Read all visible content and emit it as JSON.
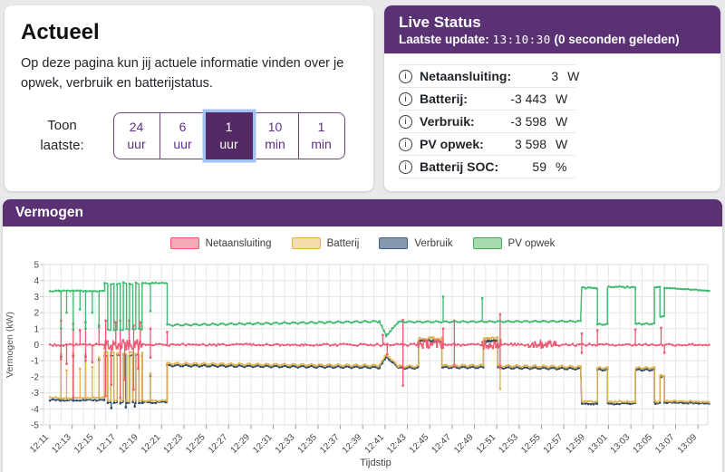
{
  "left_card": {
    "title": "Actueel",
    "description": "Op deze pagina kun jij actuele informatie vinden over je opwek, verbruik en batterijstatus.",
    "toon_label_line1": "Toon",
    "toon_label_line2": "laatste:",
    "buttons": [
      {
        "line1": "24",
        "line2": "uur",
        "selected": false
      },
      {
        "line1": "6",
        "line2": "uur",
        "selected": false
      },
      {
        "line1": "1",
        "line2": "uur",
        "selected": true
      },
      {
        "line1": "10",
        "line2": "min",
        "selected": false
      },
      {
        "line1": "1",
        "line2": "min",
        "selected": false
      }
    ]
  },
  "live_status": {
    "title": "Live Status",
    "update_label": "Laatste update:",
    "update_time": "13:10:30",
    "update_ago": "(0 seconden geleden)",
    "rows": [
      {
        "label": "Netaansluiting:",
        "value": "3",
        "unit": "W"
      },
      {
        "label": "Batterij:",
        "value": "-3 443",
        "unit": "W"
      },
      {
        "label": "Verbruik:",
        "value": "-3 598",
        "unit": "W"
      },
      {
        "label": "PV opwek:",
        "value": "3 598",
        "unit": "W"
      },
      {
        "label": "Batterij SOC:",
        "value": "59",
        "unit": "%"
      }
    ]
  },
  "chart_card": {
    "title": "Vermogen"
  },
  "colors": {
    "accent_purple": "#5a3173",
    "selected_button": "#542a64",
    "focus_ring": "#a3c4f3",
    "page_bg": "#e9e9eb"
  },
  "chart_data": {
    "type": "line",
    "xlabel": "Tijdstip",
    "ylabel": "Vermogen (kW)",
    "ylim": [
      -5,
      5
    ],
    "y_tick_step": 1,
    "x_minutes_span": 59.5,
    "x_tick_every_min": 2,
    "x_minor_grid_min": 1,
    "grid": true,
    "legend_position": "top-center",
    "x_tick_labels": [
      "12:11",
      "12:13",
      "12:15",
      "12:17",
      "12:19",
      "12:21",
      "12:23",
      "12:25",
      "12:27",
      "12:29",
      "12:31",
      "12:33",
      "12:35",
      "12:37",
      "12:39",
      "12:41",
      "12:43",
      "12:45",
      "12:47",
      "12:49",
      "12:51",
      "12:53",
      "12:55",
      "12:57",
      "12:59",
      "13:01",
      "13:03",
      "13:05",
      "13:07",
      "13:09"
    ],
    "seed": 1337,
    "legend": [
      {
        "name": "Netaansluiting",
        "fill": "#f6aab8",
        "border": "#ee5873"
      },
      {
        "name": "Batterij",
        "fill": "#f3ddab",
        "border": "#e0b14c"
      },
      {
        "name": "Verbruik",
        "fill": "#8499ad",
        "border": "#43647f"
      },
      {
        "name": "PV opwek",
        "fill": "#a5dbad",
        "border": "#42a864"
      }
    ],
    "series": [
      {
        "name": "Verbruik",
        "color": "#2f4a63",
        "z": 1,
        "segments": [
          {
            "t0": 0,
            "t1": 0.8,
            "v0": -3.45,
            "v1": -3.45,
            "noise": 0.04,
            "dt": 0.15
          },
          {
            "t0": 0.8,
            "t1": 4.9,
            "v0": -3.46,
            "v1": -3.46,
            "noise": 0.05,
            "dt": 0.15
          },
          {
            "type": "square",
            "t0": 4.9,
            "t1": 8.3,
            "hi": -0.65,
            "lo": -3.62,
            "period": 0.56,
            "noise": 0.08
          },
          {
            "t0": 8.3,
            "t1": 10.5,
            "v0": -3.6,
            "v1": -3.6,
            "noise": 0.05,
            "dt": 0.15
          },
          {
            "t0": 10.5,
            "t1": 29.5,
            "v0": -1.3,
            "v1": -1.42,
            "wave": 0.05,
            "wp": 0.8,
            "dt": 0.12
          },
          {
            "t0": 29.5,
            "t1": 30.1,
            "v0": -1.42,
            "v1": -0.75,
            "noise": 0.05,
            "dt": 0.15
          },
          {
            "t0": 30.1,
            "t1": 31.2,
            "v0": -0.75,
            "v1": -1.45,
            "noise": 0.05,
            "dt": 0.15
          },
          {
            "t0": 31.2,
            "t1": 33.0,
            "v0": -1.45,
            "v1": -1.45,
            "wave": 0.05,
            "wp": 0.8,
            "dt": 0.12
          },
          {
            "t0": 33.0,
            "t1": 35.1,
            "v0": 0.22,
            "v1": 0.22,
            "noise": 0.08,
            "dt": 0.1
          },
          {
            "t0": 35.1,
            "t1": 38.8,
            "v0": -1.42,
            "v1": -1.42,
            "wave": 0.05,
            "wp": 0.8,
            "dt": 0.12
          },
          {
            "t0": 38.8,
            "t1": 40.1,
            "v0": 0.25,
            "v1": 0.25,
            "noise": 0.08,
            "dt": 0.1
          },
          {
            "t0": 40.1,
            "t1": 47.5,
            "v0": -1.44,
            "v1": -1.5,
            "wave": 0.05,
            "wp": 0.8,
            "dt": 0.12
          },
          {
            "t0": 47.6,
            "t1": 49.0,
            "v0": -3.68,
            "v1": -3.68,
            "noise": 0.05,
            "dt": 0.12
          },
          {
            "t0": 49.0,
            "t1": 49.9,
            "v0": -1.57,
            "v1": -1.57,
            "wave": 0.05,
            "wp": 0.7,
            "dt": 0.12
          },
          {
            "t0": 49.9,
            "t1": 52.4,
            "v0": -3.68,
            "v1": -3.68,
            "noise": 0.05,
            "dt": 0.12
          },
          {
            "t0": 52.4,
            "t1": 54.1,
            "v0": -1.57,
            "v1": -1.57,
            "wave": 0.05,
            "wp": 0.7,
            "dt": 0.12
          },
          {
            "t0": 54.1,
            "t1": 54.6,
            "v0": -3.66,
            "v1": -3.66,
            "noise": 0.05,
            "dt": 0.12
          },
          {
            "t0": 54.6,
            "t1": 55.0,
            "v0": -2.0,
            "v1": -2.0,
            "noise": 0.05,
            "dt": 0.12
          },
          {
            "t0": 55.0,
            "t1": 59.0,
            "v0": -3.6,
            "v1": -3.66,
            "noise": 0.04,
            "dt": 0.12
          }
        ],
        "spikes": [
          [
            1.0,
            -0.75
          ],
          [
            2.1,
            -0.7
          ],
          [
            3.2,
            -0.75
          ],
          [
            4.4,
            -0.95
          ],
          [
            5.5,
            -3.95
          ],
          [
            6.8,
            -3.9
          ],
          [
            7.6,
            -3.85
          ],
          [
            9.0,
            -1.95
          ]
        ]
      },
      {
        "name": "Batterij",
        "color": "#e0b14c",
        "z": 2,
        "segments": [
          {
            "t0": 0,
            "t1": 0.8,
            "v0": -3.3,
            "v1": -3.3,
            "noise": 0.04,
            "dt": 0.15
          },
          {
            "t0": 0.8,
            "t1": 4.9,
            "v0": -3.32,
            "v1": -3.32,
            "noise": 0.05,
            "dt": 0.15
          },
          {
            "type": "square",
            "t0": 4.9,
            "t1": 8.3,
            "hi": -0.5,
            "lo": -3.5,
            "period": 0.56,
            "noise": 0.08
          },
          {
            "t0": 8.3,
            "t1": 10.5,
            "v0": -3.5,
            "v1": -3.5,
            "noise": 0.05,
            "dt": 0.15
          },
          {
            "t0": 10.5,
            "t1": 29.5,
            "v0": -1.18,
            "v1": -1.3,
            "wave": 0.06,
            "wp": 0.8,
            "dt": 0.12
          },
          {
            "t0": 29.5,
            "t1": 30.1,
            "v0": -1.3,
            "v1": -0.62,
            "noise": 0.05,
            "dt": 0.15
          },
          {
            "t0": 30.1,
            "t1": 31.2,
            "v0": -0.62,
            "v1": -1.35,
            "noise": 0.05,
            "dt": 0.15
          },
          {
            "t0": 31.2,
            "t1": 33.0,
            "v0": -1.35,
            "v1": -1.35,
            "wave": 0.06,
            "wp": 0.8,
            "dt": 0.12
          },
          {
            "t0": 33.0,
            "t1": 35.1,
            "v0": 0.38,
            "v1": 0.38,
            "noise": 0.09,
            "dt": 0.1
          },
          {
            "t0": 35.1,
            "t1": 38.8,
            "v0": -1.3,
            "v1": -1.3,
            "wave": 0.06,
            "wp": 0.8,
            "dt": 0.12
          },
          {
            "t0": 38.8,
            "t1": 40.1,
            "v0": 0.4,
            "v1": 0.4,
            "noise": 0.09,
            "dt": 0.1
          },
          {
            "t0": 40.1,
            "t1": 47.5,
            "v0": -1.32,
            "v1": -1.38,
            "wave": 0.06,
            "wp": 0.8,
            "dt": 0.12
          },
          {
            "t0": 47.6,
            "t1": 49.0,
            "v0": -3.55,
            "v1": -3.55,
            "noise": 0.05,
            "dt": 0.12
          },
          {
            "t0": 49.0,
            "t1": 49.9,
            "v0": -1.45,
            "v1": -1.45,
            "wave": 0.05,
            "wp": 0.7,
            "dt": 0.12
          },
          {
            "t0": 49.9,
            "t1": 52.4,
            "v0": -3.55,
            "v1": -3.55,
            "noise": 0.05,
            "dt": 0.12
          },
          {
            "t0": 52.4,
            "t1": 54.1,
            "v0": -1.45,
            "v1": -1.45,
            "wave": 0.05,
            "wp": 0.7,
            "dt": 0.12
          },
          {
            "t0": 54.1,
            "t1": 54.6,
            "v0": -3.55,
            "v1": -3.55,
            "noise": 0.05,
            "dt": 0.12
          },
          {
            "t0": 54.6,
            "t1": 55.0,
            "v0": -1.9,
            "v1": -1.9,
            "noise": 0.05,
            "dt": 0.12
          },
          {
            "t0": 55.0,
            "t1": 59.0,
            "v0": -3.5,
            "v1": -3.57,
            "noise": 0.04,
            "dt": 0.12
          }
        ],
        "spikes": [
          [
            1.0,
            -0.6
          ],
          [
            1.5,
            -1.6
          ],
          [
            2.1,
            -0.55
          ],
          [
            2.7,
            -1.5
          ],
          [
            3.2,
            -0.6
          ],
          [
            3.8,
            -1.4
          ],
          [
            4.4,
            -0.8
          ],
          [
            9.0,
            -1.8
          ],
          [
            40.3,
            -2.75
          ]
        ]
      },
      {
        "name": "Netaansluiting",
        "color": "#ee5873",
        "z": 3,
        "segments": [
          {
            "t0": 0,
            "t1": 4.9,
            "v0": 0,
            "v1": 0,
            "noise": 0.07,
            "dt": 0.15
          },
          {
            "t0": 4.9,
            "t1": 8.3,
            "v0": 0,
            "v1": 0,
            "noise": 0.3,
            "dt": 0.07
          },
          {
            "t0": 8.3,
            "t1": 32.9,
            "v0": 0,
            "v1": 0,
            "noise": 0.07,
            "dt": 0.15
          },
          {
            "t0": 32.9,
            "t1": 35.2,
            "v0": 0.05,
            "v1": 0.05,
            "noise": 0.28,
            "dt": 0.07
          },
          {
            "t0": 35.2,
            "t1": 38.7,
            "v0": 0,
            "v1": 0,
            "noise": 0.07,
            "dt": 0.15
          },
          {
            "t0": 38.7,
            "t1": 40.4,
            "v0": 0.05,
            "v1": 0.05,
            "noise": 0.3,
            "dt": 0.07
          },
          {
            "t0": 40.4,
            "t1": 42.8,
            "v0": 0,
            "v1": 0,
            "noise": 0.08,
            "dt": 0.15
          },
          {
            "t0": 42.8,
            "t1": 45.3,
            "v0": 0.05,
            "v1": 0.05,
            "noise": 0.26,
            "dt": 0.07
          },
          {
            "t0": 45.3,
            "t1": 59.0,
            "v0": 0,
            "v1": 0,
            "noise": 0.07,
            "dt": 0.15
          }
        ],
        "spikes": [
          [
            1.0,
            1.5
          ],
          [
            1.0,
            -0.9
          ],
          [
            1.5,
            -1.2
          ],
          [
            2.1,
            1.3
          ],
          [
            2.1,
            -3.3
          ],
          [
            2.7,
            0.9
          ],
          [
            3.2,
            1.4
          ],
          [
            3.2,
            -1.0
          ],
          [
            3.8,
            -1.1
          ],
          [
            4.4,
            1.2
          ],
          [
            5.0,
            1.5
          ],
          [
            5.0,
            -3.2
          ],
          [
            5.5,
            -2.5
          ],
          [
            5.9,
            1.4
          ],
          [
            6.3,
            1.5
          ],
          [
            6.3,
            -3.3
          ],
          [
            6.7,
            -2.2
          ],
          [
            7.1,
            1.5
          ],
          [
            7.5,
            1.2
          ],
          [
            7.5,
            -2.8
          ],
          [
            7.9,
            -1.5
          ],
          [
            8.1,
            1.4
          ],
          [
            9.0,
            1.0
          ],
          [
            9.0,
            -0.8
          ],
          [
            10.5,
            0.8
          ],
          [
            29.8,
            0.6
          ],
          [
            30.2,
            -0.6
          ],
          [
            31.6,
            1.55
          ],
          [
            31.6,
            -2.55
          ],
          [
            35.2,
            1.0
          ],
          [
            36.2,
            1.5
          ],
          [
            36.2,
            -1.35
          ],
          [
            40.3,
            1.9
          ],
          [
            40.3,
            -1.45
          ],
          [
            47.6,
            0.7
          ],
          [
            47.6,
            -0.5
          ],
          [
            49.0,
            0.9
          ],
          [
            52.4,
            0.95
          ],
          [
            54.7,
            1.05
          ],
          [
            55.0,
            -0.5
          ]
        ]
      },
      {
        "name": "PV opwek",
        "color": "#3cb96d",
        "z": 4,
        "segments": [
          {
            "t0": 0,
            "t1": 0.8,
            "v0": 3.35,
            "v1": 3.35,
            "noise": 0.03,
            "dt": 0.15
          },
          {
            "t0": 0.8,
            "t1": 4.9,
            "v0": 3.36,
            "v1": 3.36,
            "noise": 0.04,
            "dt": 0.15
          },
          {
            "type": "square",
            "t0": 4.9,
            "t1": 8.3,
            "hi": 3.82,
            "lo": 0.95,
            "period": 0.56,
            "noise": 0.07
          },
          {
            "t0": 8.3,
            "t1": 10.5,
            "v0": 3.85,
            "v1": 3.82,
            "noise": 0.04,
            "dt": 0.15
          },
          {
            "t0": 10.5,
            "t1": 29.5,
            "v0": 1.22,
            "v1": 1.45,
            "wave": 0.05,
            "wp": 0.8,
            "dt": 0.12
          },
          {
            "t0": 29.5,
            "t1": 30.1,
            "v0": 1.42,
            "v1": 0.55,
            "noise": 0.06,
            "dt": 0.12
          },
          {
            "t0": 30.1,
            "t1": 31.2,
            "v0": 0.55,
            "v1": 1.42,
            "noise": 0.06,
            "dt": 0.12
          },
          {
            "t0": 31.2,
            "t1": 47.5,
            "v0": 1.42,
            "v1": 1.46,
            "wave": 0.04,
            "wp": 0.8,
            "dt": 0.12
          },
          {
            "t0": 47.6,
            "t1": 49.0,
            "v0": 3.55,
            "v1": 3.55,
            "noise": 0.05,
            "dt": 0.12
          },
          {
            "t0": 49.0,
            "t1": 49.9,
            "v0": 1.27,
            "v1": 1.27,
            "wave": 0.04,
            "wp": 0.7,
            "dt": 0.12
          },
          {
            "t0": 49.9,
            "t1": 52.4,
            "v0": 3.6,
            "v1": 3.6,
            "noise": 0.05,
            "dt": 0.12
          },
          {
            "t0": 52.4,
            "t1": 54.1,
            "v0": 1.3,
            "v1": 1.3,
            "wave": 0.04,
            "wp": 0.7,
            "dt": 0.12
          },
          {
            "t0": 54.1,
            "t1": 54.6,
            "v0": 3.58,
            "v1": 3.58,
            "noise": 0.04,
            "dt": 0.12
          },
          {
            "t0": 54.6,
            "t1": 55.0,
            "v0": 1.75,
            "v1": 1.75,
            "noise": 0.04,
            "dt": 0.12
          },
          {
            "t0": 55.0,
            "t1": 59.0,
            "v0": 3.52,
            "v1": 3.38,
            "noise": 0.03,
            "dt": 0.12
          }
        ],
        "spikes": [
          [
            1.0,
            1.0
          ],
          [
            1.5,
            2.0
          ],
          [
            2.1,
            0.95
          ],
          [
            2.7,
            2.2
          ],
          [
            3.2,
            1.0
          ],
          [
            3.8,
            2.0
          ],
          [
            4.4,
            1.1
          ],
          [
            9.0,
            2.1
          ],
          [
            35.2,
            3.0
          ],
          [
            38.7,
            2.9
          ]
        ]
      }
    ]
  }
}
